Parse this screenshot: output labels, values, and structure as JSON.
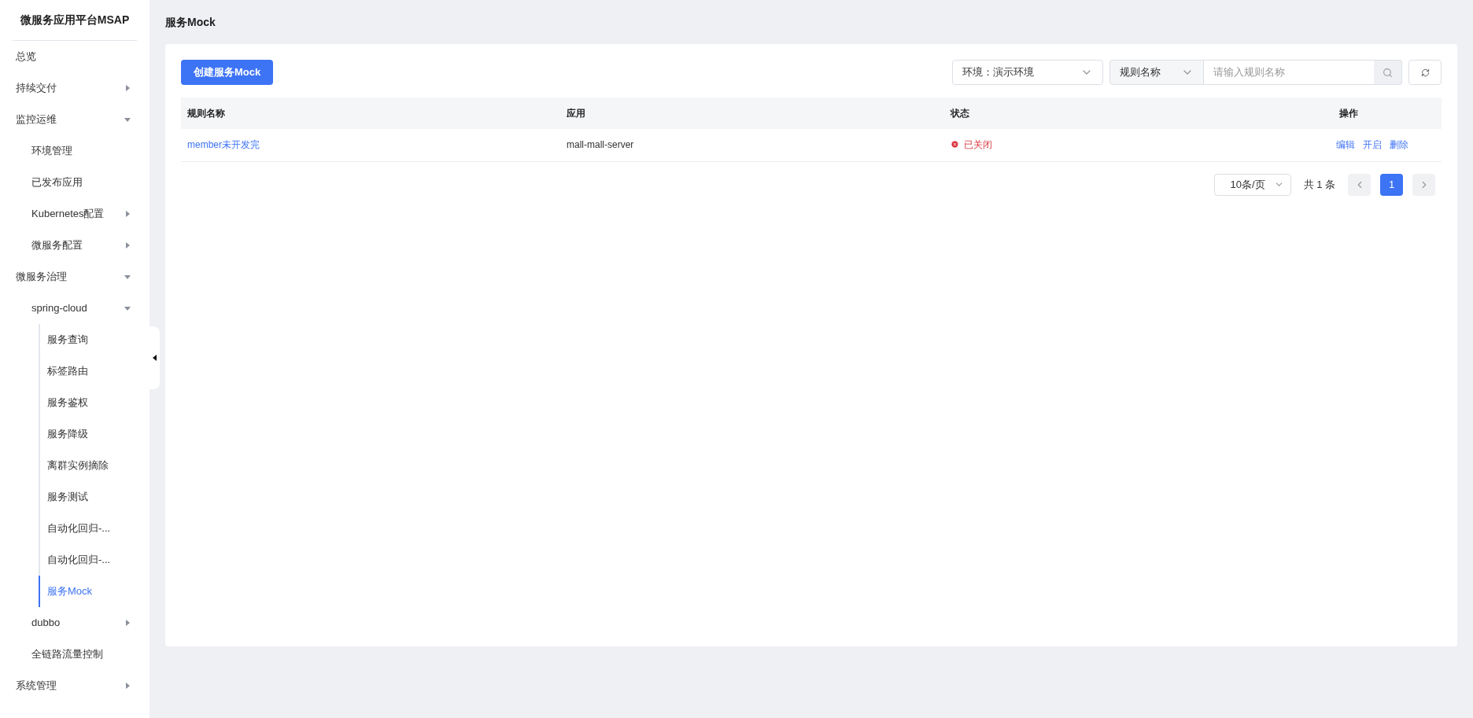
{
  "sidebar": {
    "title": "微服务应用平台MSAP",
    "items": [
      {
        "label": "总览",
        "selected": false
      },
      {
        "label": "持续交付",
        "expanded": false,
        "selected": false
      },
      {
        "label": "监控运维",
        "expanded": true,
        "selected": false,
        "children": [
          {
            "label": "环境管理",
            "selected": false
          },
          {
            "label": "已发布应用",
            "selected": false
          },
          {
            "label": "Kubernetes配置",
            "expanded": false,
            "selected": false
          },
          {
            "label": "微服务配置",
            "expanded": false,
            "selected": false
          }
        ]
      },
      {
        "label": "微服务治理",
        "expanded": true,
        "selected": false,
        "children": [
          {
            "label": "spring-cloud",
            "expanded": true,
            "selected": false,
            "children": [
              {
                "label": "服务查询",
                "selected": false
              },
              {
                "label": "标签路由",
                "selected": false
              },
              {
                "label": "服务鉴权",
                "selected": false
              },
              {
                "label": "服务降级",
                "selected": false
              },
              {
                "label": "离群实例摘除",
                "selected": false
              },
              {
                "label": "服务测试",
                "selected": false
              },
              {
                "label": "自动化回归-...",
                "selected": false
              },
              {
                "label": "自动化回归-...",
                "selected": false
              },
              {
                "label": "服务Mock",
                "selected": true
              }
            ]
          },
          {
            "label": "dubbo",
            "expanded": false,
            "selected": false
          },
          {
            "label": "全链路流量控制",
            "selected": false
          }
        ]
      },
      {
        "label": "系统管理",
        "expanded": false,
        "selected": false
      }
    ]
  },
  "page_title": "服务Mock",
  "toolbar": {
    "create_button": "创建服务Mock",
    "environment": "环境：演示环境",
    "search_type": "规则名称",
    "search": {
      "placeholder": "请输入规则名称"
    }
  },
  "table": {
    "columns": [
      "规则名称",
      "应用",
      "状态",
      "操作"
    ],
    "rows": [
      {
        "name": "member未开发完",
        "app": "mall-mall-server",
        "status": "已关闭",
        "kind": "closed",
        "actions": [
          "编辑",
          "开启",
          "删除"
        ]
      }
    ]
  },
  "pagination": {
    "page_size": "10条/页",
    "total": "共 1 条",
    "pages": [
      {
        "label": "1",
        "selected": true
      }
    ]
  }
}
